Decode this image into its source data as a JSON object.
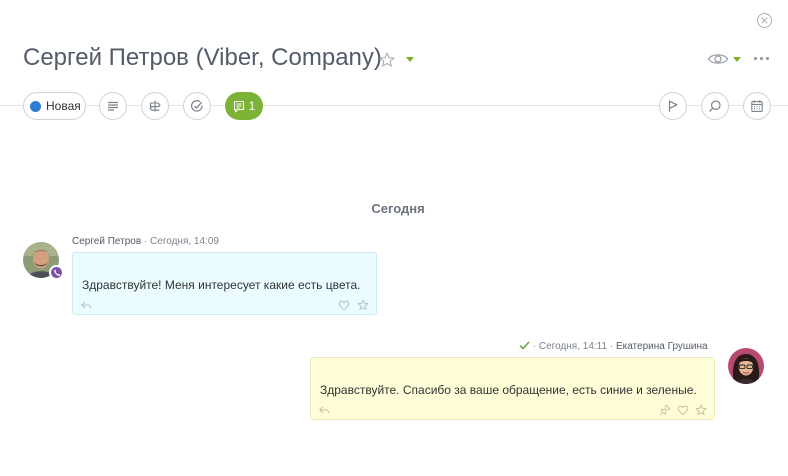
{
  "header": {
    "title": "Сергей Петров (Viber, Company)"
  },
  "toolbar": {
    "status_label": "Новая",
    "status_color": "#2f7cd4",
    "chat_count": "1",
    "chat_color": "#7cb336",
    "icons": [
      "list-icon",
      "transfer-icon",
      "checkmark-circle-icon",
      "chat-icon",
      "flag-icon",
      "search-icon",
      "calendar-icon"
    ]
  },
  "feed": {
    "date_separator": "Сегодня",
    "messages": [
      {
        "author": "Сергей Петров",
        "time": "· Сегодня, 14:09",
        "text": "Здравствуйте! Меня интересует какие есть цвета.",
        "direction": "incoming",
        "channel": "viber"
      },
      {
        "author": "Екатерина Грушина",
        "time": "· Сегодня, 14:11 ·",
        "text": "Здравствуйте. Спасибо за ваше обращение, есть синие и зеленые.",
        "direction": "outgoing",
        "delivered": true
      }
    ]
  },
  "colors": {
    "accent_green": "#7fb01f",
    "incoming_bubble": "#eafcff",
    "outgoing_bubble": "#fffdd8",
    "viber_purple": "#7d51a8"
  }
}
